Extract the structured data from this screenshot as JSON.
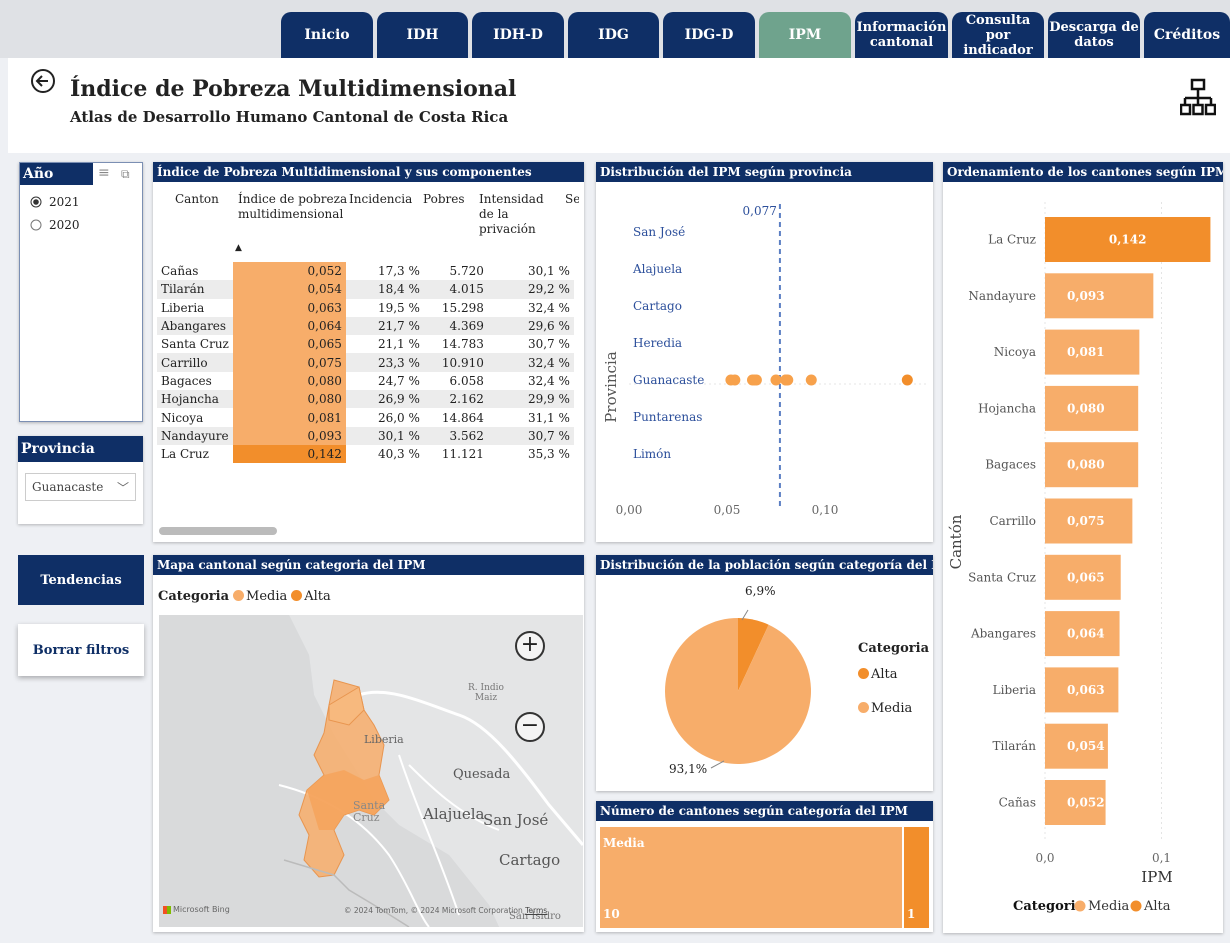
{
  "nav": {
    "tabs": [
      {
        "label": "Inicio"
      },
      {
        "label": "IDH"
      },
      {
        "label": "IDH-D"
      },
      {
        "label": "IDG"
      },
      {
        "label": "IDG-D"
      },
      {
        "label": "IPM"
      },
      {
        "label": "Información cantonal"
      },
      {
        "label": "Consulta por indicador"
      },
      {
        "label": "Descarga de datos"
      },
      {
        "label": "Créditos"
      }
    ]
  },
  "header": {
    "title": "Índice de Pobreza Multidimensional",
    "subtitle": "Atlas de Desarrollo Humano Cantonal de Costa Rica"
  },
  "filters": {
    "year_label": "Año",
    "years": [
      {
        "label": "2021",
        "selected": true
      },
      {
        "label": "2020",
        "selected": false
      }
    ],
    "province_label": "Provincia",
    "province_value": "Guanacaste"
  },
  "buttons": {
    "trends": "Tendencias",
    "clear": "Borrar filtros"
  },
  "table": {
    "title": "Índice de Pobreza Multidimensional y sus componentes",
    "headers": [
      "Canton",
      "Índice de pobreza multidimensional",
      "Incidencia",
      "Pobres",
      "Intensidad de la privación",
      "Se"
    ],
    "rows": [
      [
        "Cañas",
        "0,052",
        "17,3 %",
        "5.720",
        "30,1 %"
      ],
      [
        "Tilarán",
        "0,054",
        "18,4 %",
        "4.015",
        "29,2 %"
      ],
      [
        "Liberia",
        "0,063",
        "19,5 %",
        "15.298",
        "32,4 %"
      ],
      [
        "Abangares",
        "0,064",
        "21,7 %",
        "4.369",
        "29,6 %"
      ],
      [
        "Santa Cruz",
        "0,065",
        "21,1 %",
        "14.783",
        "30,7 %"
      ],
      [
        "Carrillo",
        "0,075",
        "23,3 %",
        "10.910",
        "32,4 %"
      ],
      [
        "Bagaces",
        "0,080",
        "24,7 %",
        "6.058",
        "32,4 %"
      ],
      [
        "Hojancha",
        "0,080",
        "26,9 %",
        "2.162",
        "29,9 %"
      ],
      [
        "Nicoya",
        "0,081",
        "26,0 %",
        "14.864",
        "31,1 %"
      ],
      [
        "Nandayure",
        "0,093",
        "30,1 %",
        "3.562",
        "30,7 %"
      ],
      [
        "La Cruz",
        "0,142",
        "40,3 %",
        "11.121",
        "35,3 %"
      ]
    ]
  },
  "dist_chart": {
    "title": "Distribución del IPM según provincia",
    "ylabel": "Provincia",
    "ref_label": "0,077",
    "categories": [
      "San José",
      "Alajuela",
      "Cartago",
      "Heredia",
      "Guanacaste",
      "Puntarenas",
      "Limón"
    ],
    "xticks": [
      "0,00",
      "0,05",
      "0,10"
    ]
  },
  "map": {
    "title": "Mapa cantonal según categoria del IPM",
    "legend_title": "Categoria",
    "legend_items": [
      "Media",
      "Alta"
    ],
    "place_names": [
      "R. Indio Maiz",
      "Liberia",
      "Quesada",
      "Santa Cruz",
      "Alajuela",
      "San José",
      "Cartago",
      "San Isidro"
    ],
    "zoom_in": "+",
    "zoom_out": "−",
    "bing_label": "Microsoft Bing",
    "copyright": "© 2024 TomTom, © 2024 Microsoft Corporation",
    "terms": "Terms"
  },
  "pie": {
    "title": "Distribución de la población según categoría del IPM",
    "label_alta": "6,9%",
    "label_media": "93,1%",
    "legend_title": "Categoria",
    "legend_items": [
      "Alta",
      "Media"
    ]
  },
  "counts": {
    "title": "Número de cantones según categoría del IPM",
    "media_label": "Media",
    "media_count": "10",
    "alta_count": "1"
  },
  "ranking": {
    "title": "Ordenamiento de los cantones según IPM",
    "ylabel": "Cantón",
    "xlabel": "IPM",
    "xticks": [
      "0,0",
      "0,1"
    ],
    "legend_title": "Categoria",
    "legend_items": [
      "Media",
      "Alta"
    ]
  },
  "chart_data": [
    {
      "type": "scatter",
      "title": "Distribución del IPM según provincia",
      "ylabel": "Provincia",
      "categories": [
        "San José",
        "Alajuela",
        "Cartago",
        "Heredia",
        "Guanacaste",
        "Puntarenas",
        "Limón"
      ],
      "series": [
        {
          "name": "Guanacaste",
          "x": [
            0.052,
            0.054,
            0.063,
            0.064,
            0.065,
            0.075,
            0.08,
            0.08,
            0.081,
            0.093,
            0.142
          ]
        }
      ],
      "reference_line": 0.077,
      "xlim": [
        0,
        0.14
      ],
      "grid": false
    },
    {
      "type": "pie",
      "title": "Distribución de la población según categoría del IPM",
      "categories": [
        "Alta",
        "Media"
      ],
      "values": [
        6.9,
        93.1
      ],
      "colors": [
        "#f28e2b",
        "#f7ad6a"
      ]
    },
    {
      "type": "bar",
      "title": "Número de cantones según categoría del IPM",
      "categories": [
        "Media",
        "Alta"
      ],
      "values": [
        10,
        1
      ]
    },
    {
      "type": "bar",
      "orientation": "horizontal",
      "title": "Ordenamiento de los cantones según IPM",
      "xlabel": "IPM",
      "ylabel": "Cantón",
      "categories": [
        "La Cruz",
        "Nandayure",
        "Nicoya",
        "Hojancha",
        "Bagaces",
        "Carrillo",
        "Santa Cruz",
        "Abangares",
        "Liberia",
        "Tilarán",
        "Cañas"
      ],
      "values": [
        0.142,
        0.093,
        0.081,
        0.08,
        0.08,
        0.075,
        0.065,
        0.064,
        0.063,
        0.054,
        0.052
      ],
      "value_labels": [
        "0,142",
        "0,093",
        "0,081",
        "0,080",
        "0,080",
        "0,075",
        "0,065",
        "0,064",
        "0,063",
        "0,054",
        "0,052"
      ],
      "category_of_bar": [
        "Alta",
        "Media",
        "Media",
        "Media",
        "Media",
        "Media",
        "Media",
        "Media",
        "Media",
        "Media",
        "Media"
      ],
      "xlim": [
        0,
        0.15
      ],
      "colors": {
        "Media": "#f7ad6a",
        "Alta": "#f28e2b"
      }
    }
  ]
}
